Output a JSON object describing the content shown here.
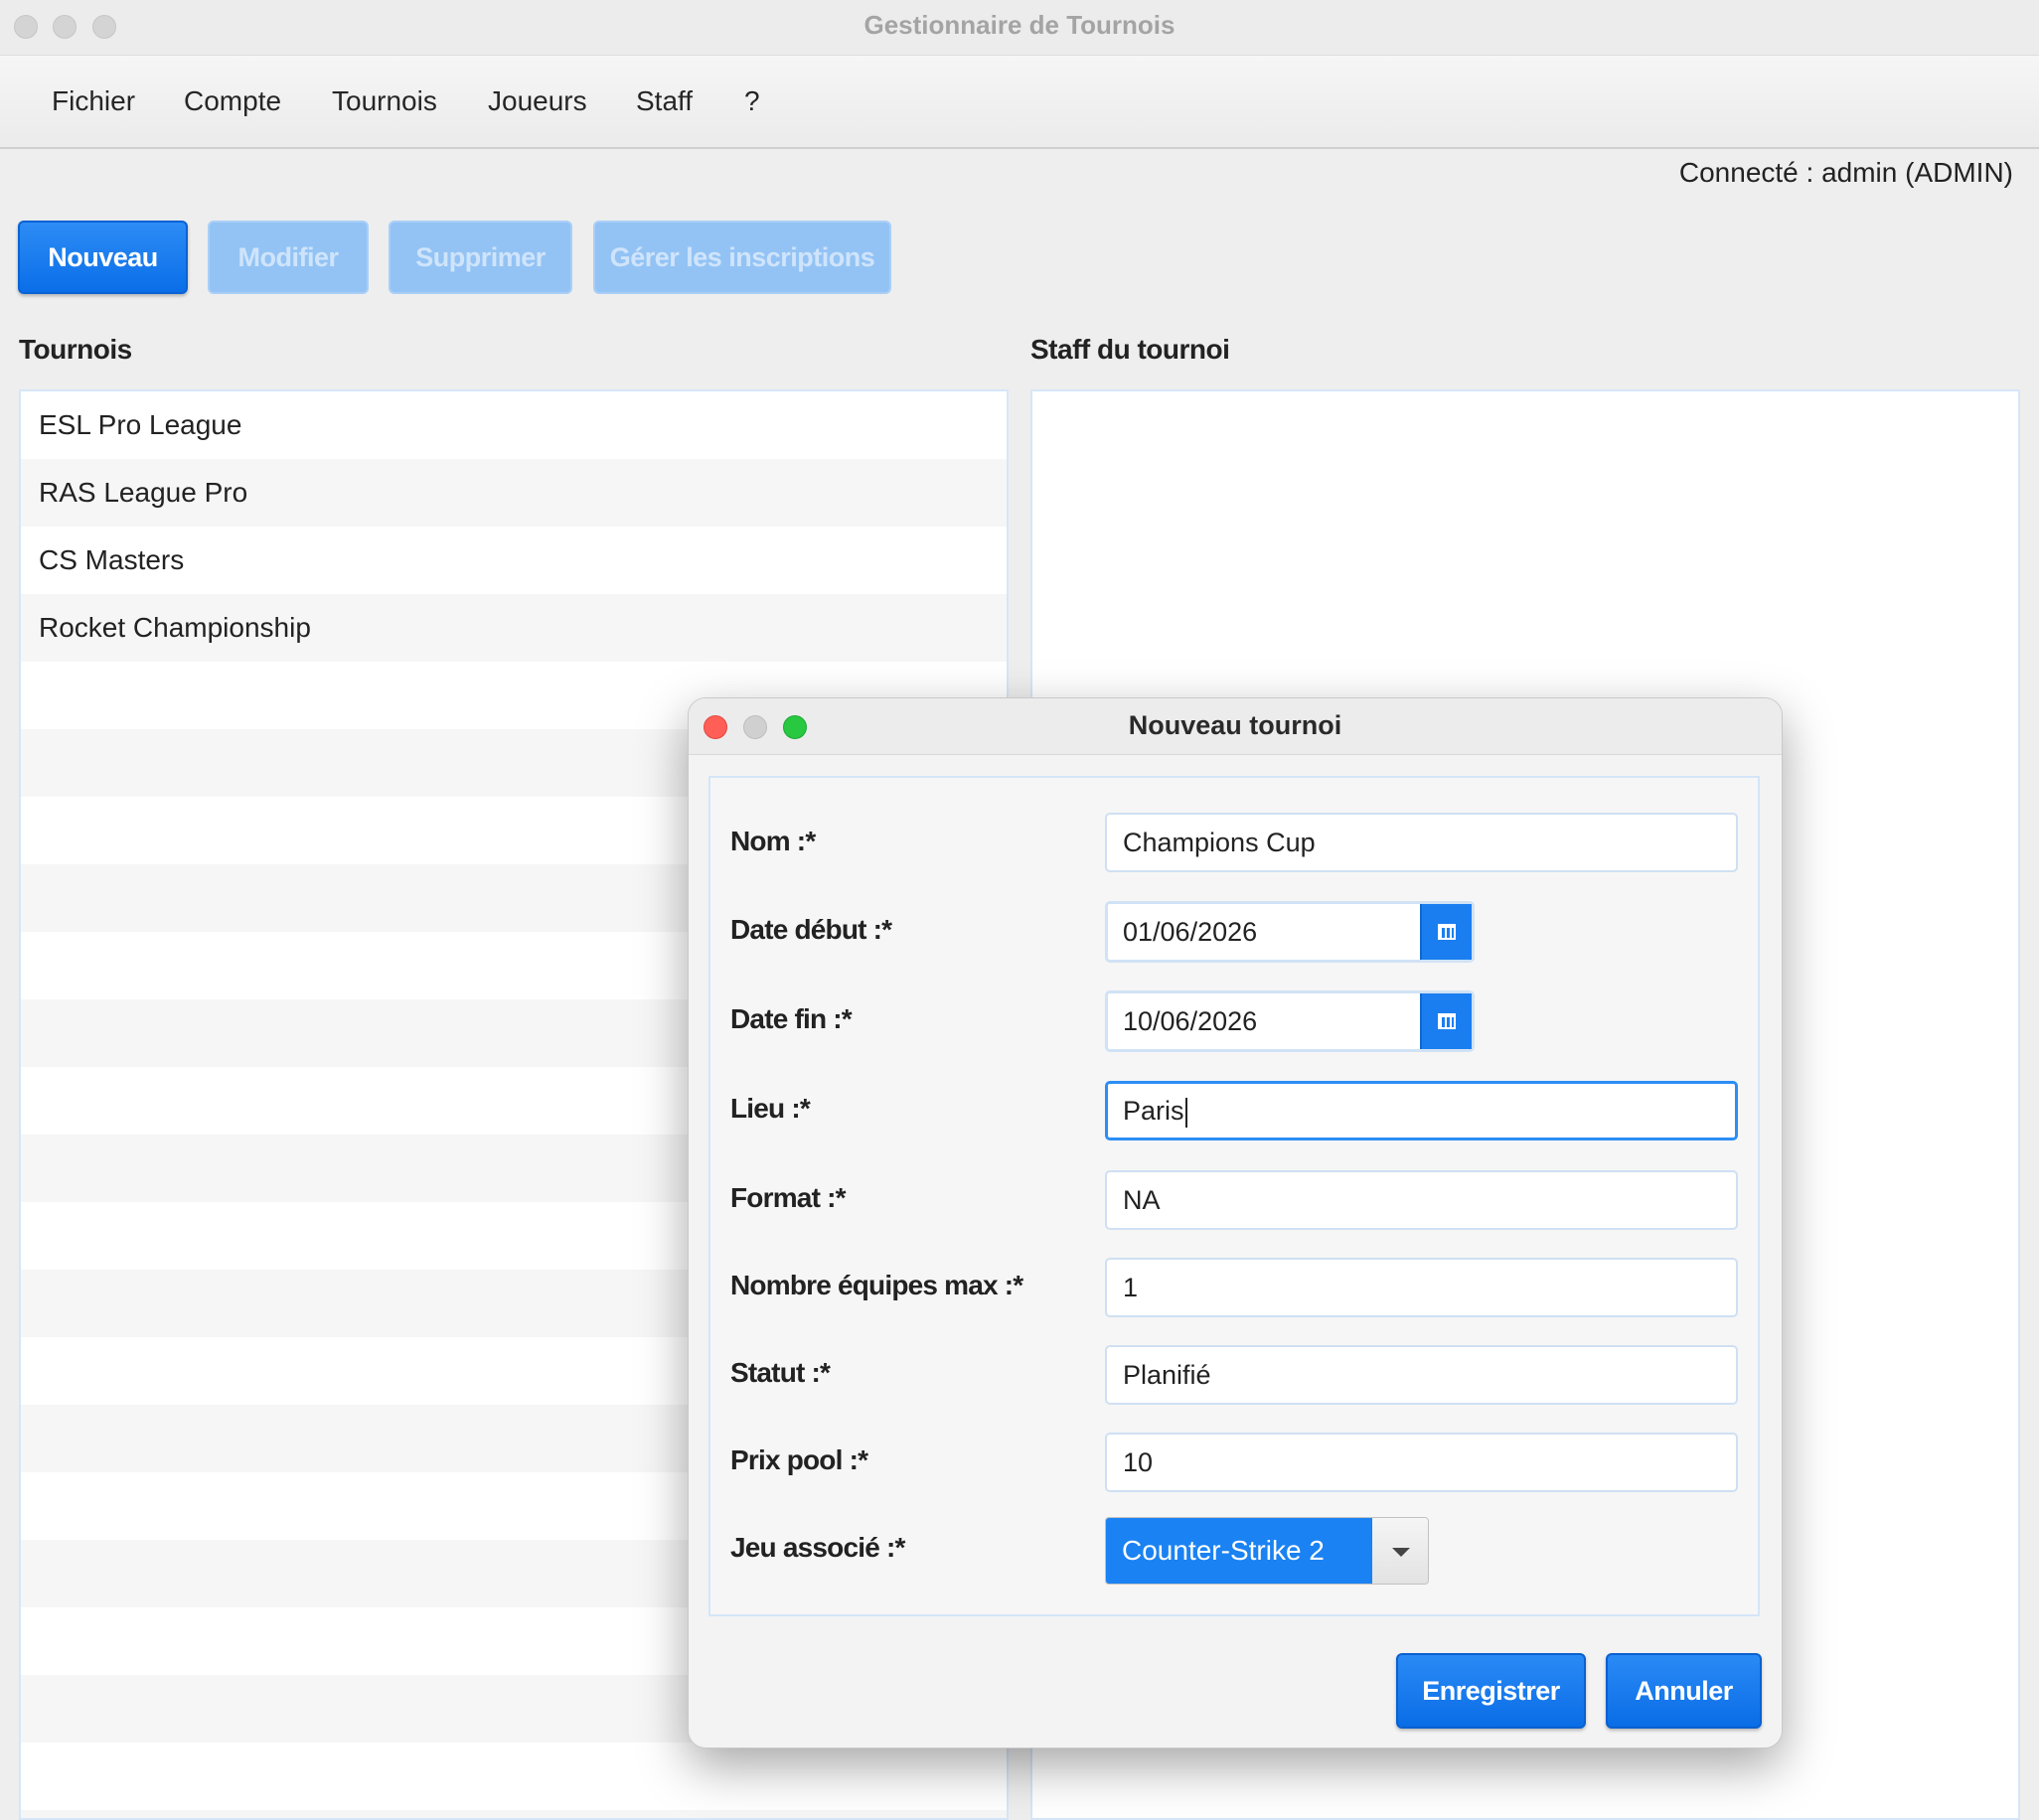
{
  "window": {
    "title": "Gestionnaire de Tournois"
  },
  "menu": {
    "items": [
      "Fichier",
      "Compte",
      "Tournois",
      "Joueurs",
      "Staff",
      "?"
    ]
  },
  "status": {
    "connected": "Connecté : admin (ADMIN)"
  },
  "toolbar": {
    "new_label": "Nouveau",
    "edit_label": "Modifier",
    "delete_label": "Supprimer",
    "registrations_label": "Gérer les inscriptions"
  },
  "tournois": {
    "heading": "Tournois",
    "items": [
      "ESL Pro League",
      "RAS League Pro",
      "CS Masters",
      "Rocket Championship"
    ]
  },
  "staff": {
    "heading": "Staff du tournoi"
  },
  "dialog": {
    "title": "Nouveau tournoi",
    "fields": {
      "nom": {
        "label": "Nom :*",
        "value": "Champions Cup"
      },
      "date_debut": {
        "label": "Date début :*",
        "value": "01/06/2026"
      },
      "date_fin": {
        "label": "Date fin :*",
        "value": "10/06/2026"
      },
      "lieu": {
        "label": "Lieu :*",
        "value": "Paris"
      },
      "format": {
        "label": "Format :*",
        "value": "NA"
      },
      "nb_equipes": {
        "label": "Nombre équipes max :*",
        "value": "1"
      },
      "statut": {
        "label": "Statut :*",
        "value": "Planifié"
      },
      "prix_pool": {
        "label": "Prix pool :*",
        "value": "10"
      },
      "jeu": {
        "label": "Jeu associé :*",
        "value": "Counter-Strike 2"
      }
    },
    "save_label": "Enregistrer",
    "cancel_label": "Annuler"
  },
  "colors": {
    "accent": "#0a6ee8",
    "close": "#ff5f57",
    "minimize": "#d0d0d0",
    "zoom": "#28c840"
  }
}
